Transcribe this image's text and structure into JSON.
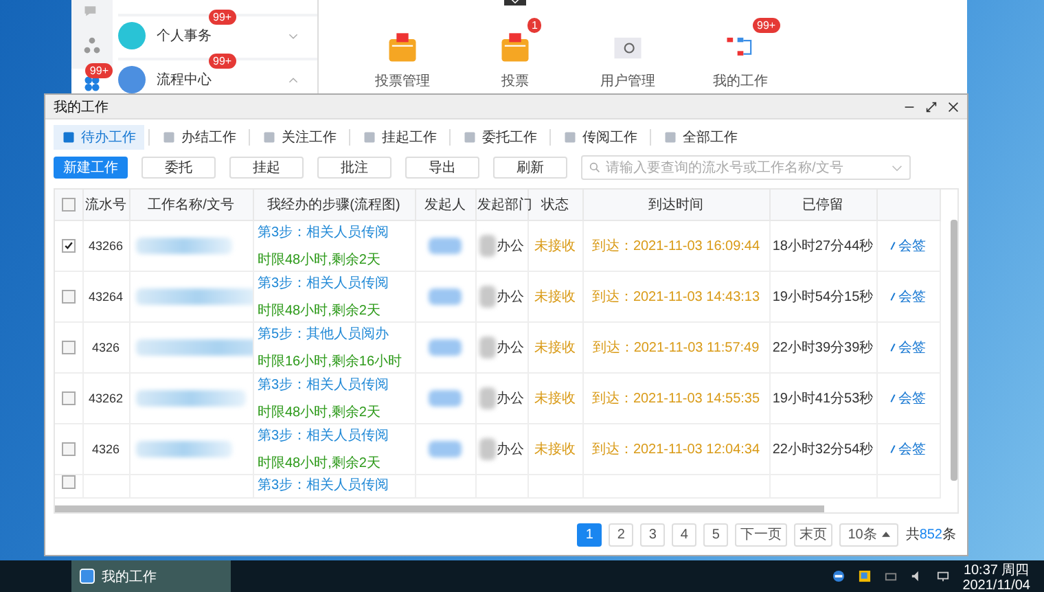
{
  "background_app": {
    "rail_badges": [
      {
        "text": "99+"
      }
    ],
    "menu": [
      {
        "label": "个人事务",
        "badge": "99+",
        "expanded": false
      },
      {
        "label": "流程中心",
        "badge": "99+",
        "expanded": true
      }
    ],
    "apps": [
      {
        "label": "投票管理",
        "kind": "vote"
      },
      {
        "label": "投票",
        "kind": "vote",
        "badge": "1"
      },
      {
        "label": "用户管理",
        "kind": "user"
      },
      {
        "label": "我的工作",
        "kind": "flow",
        "badge": "99+"
      }
    ]
  },
  "window": {
    "title": "我的工作"
  },
  "tabs": [
    {
      "label": "待办工作",
      "selected": true
    },
    {
      "label": "办结工作",
      "selected": false
    },
    {
      "label": "关注工作",
      "selected": false
    },
    {
      "label": "挂起工作",
      "selected": false
    },
    {
      "label": "委托工作",
      "selected": false
    },
    {
      "label": "传阅工作",
      "selected": false
    },
    {
      "label": "全部工作",
      "selected": false
    }
  ],
  "buttons": [
    {
      "label": "新建工作",
      "kind": "primary"
    },
    {
      "label": "委托",
      "kind": "default"
    },
    {
      "label": "挂起",
      "kind": "default"
    },
    {
      "label": "批注",
      "kind": "default"
    },
    {
      "label": "导出",
      "kind": "default"
    },
    {
      "label": "刷新",
      "kind": "default"
    }
  ],
  "search": {
    "placeholder": "请输入要查询的流水号或工作名称/文号"
  },
  "table": {
    "select_all": {
      "checked": false
    },
    "columns": [
      "流水号",
      "工作名称/文号",
      "我经办的步骤(流程图)",
      "发起人",
      "发起部门",
      "状态",
      "到达时间",
      "已停留"
    ],
    "rows": [
      {
        "checked": true,
        "id": "43266",
        "step": "第3步：相关人员传阅",
        "deadline": "时限48小时,剩余2天",
        "dept": "办公",
        "status": "未接收",
        "arrival": "到达：2021-11-03 16:09:44",
        "elapsed": "18小时27分44秒",
        "action": "会签"
      },
      {
        "checked": false,
        "id": "43264",
        "step": "第3步：相关人员传阅",
        "deadline": "时限48小时,剩余2天",
        "dept": "办公",
        "status": "未接收",
        "arrival": "到达：2021-11-03 14:43:13",
        "elapsed": "19小时54分15秒",
        "action": "会签"
      },
      {
        "checked": false,
        "id": "4326",
        "step": "第5步：其他人员阅办",
        "deadline": "时限16小时,剩余16小时",
        "dept": "办公",
        "status": "未接收",
        "arrival": "到达：2021-11-03 11:57:49",
        "elapsed": "22小时39分39秒",
        "action": "会签"
      },
      {
        "checked": false,
        "id": "43262",
        "step": "第3步：相关人员传阅",
        "deadline": "时限48小时,剩余2天",
        "dept": "办公",
        "status": "未接收",
        "arrival": "到达：2021-11-03 14:55:35",
        "elapsed": "19小时41分53秒",
        "action": "会签"
      },
      {
        "checked": false,
        "id": "4326",
        "step": "第3步：相关人员传阅",
        "deadline": "时限48小时,剩余2天",
        "dept": "办公",
        "status": "未接收",
        "arrival": "到达：2021-11-03 12:04:34",
        "elapsed": "22小时32分54秒",
        "action": "会签"
      },
      {
        "checked": false,
        "step": "第3步：相关人员传阅"
      }
    ]
  },
  "pagination": {
    "pages": [
      {
        "label": "1",
        "selected": true
      },
      {
        "label": "2",
        "selected": false
      },
      {
        "label": "3",
        "selected": false
      },
      {
        "label": "4",
        "selected": false
      },
      {
        "label": "5",
        "selected": false
      }
    ],
    "next": "下一页",
    "last": "末页",
    "page_size": "10条",
    "total_prefix": "共",
    "total": "852",
    "total_suffix": "条"
  },
  "taskbar": {
    "task": "我的工作",
    "time": "10:37 周四",
    "date": "2021/11/04"
  }
}
